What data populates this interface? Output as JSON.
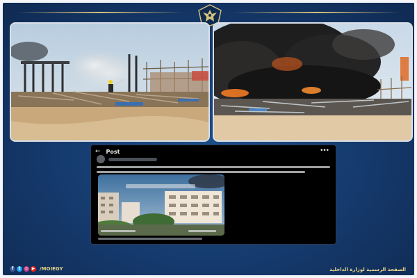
{
  "header": {
    "emblem_icon": "eagle-emblem-icon",
    "accent_color": "#d6c07e",
    "background_color": "#15396b"
  },
  "photos": [
    {
      "name": "construction-site-fire-firefighter"
    },
    {
      "name": "construction-site-black-smoke-fire"
    }
  ],
  "post": {
    "header_title": "Post",
    "back_icon": "back-arrow-icon",
    "more_icon": "more-icon"
  },
  "footer": {
    "social_icons": [
      "facebook-icon",
      "twitter-icon",
      "instagram-icon",
      "youtube-icon"
    ],
    "handle": "/MOIEGY",
    "official_page_label": "الصفحة الرسمية لوزارة الداخلية"
  }
}
